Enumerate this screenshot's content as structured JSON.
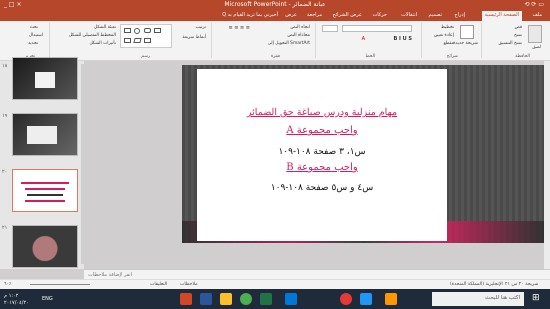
{
  "window": {
    "title": "Microsoft PowerPoint - عبانة الضمائر",
    "controls": [
      "_",
      "□",
      "×"
    ],
    "quick_access": "⟲ ⟳ ▭"
  },
  "tabs": [
    "ملف",
    "الصفحة الرئيسية",
    "إدراج",
    "تصميم",
    "انتقالات",
    "حركات",
    "عرض الشرائح",
    "مراجعة",
    "عرض",
    "Q أخبرني بما تريد القيام به"
  ],
  "ribbon": {
    "paste": "لصق",
    "clipboard_items": [
      "قص",
      "نسخ",
      "نسخ التنسيق"
    ],
    "clipboard_label": "الحافظة",
    "new_slide": "شريحة جديدة",
    "slides_items": [
      "تخطيط",
      "إعادة تعيين",
      "مقطع"
    ],
    "slides_label": "شرائح",
    "font_label": "الخط",
    "paragraph_items": [
      "اتجاه النص",
      "محاذاة النص",
      "التحويل إلى SmartArt"
    ],
    "paragraph_label": "فقرة",
    "drawing_items": [
      "ترتيب",
      "أنماط سريعة",
      "تعبئة الشكل",
      "المخطط التفصيلي للشكل",
      "تأثيرات الشكل"
    ],
    "drawing_label": "رسم",
    "editing_items": [
      "بحث",
      "استبدال",
      "تحديد"
    ],
    "editing_label": "تحرير"
  },
  "thumbnails": [
    {
      "num": "١٨"
    },
    {
      "num": "١٩"
    },
    {
      "num": "٢٠"
    },
    {
      "num": "٢١"
    }
  ],
  "slide": {
    "line1": "مهام منزلية ودرس صياغة حق الضمائر",
    "line2": "واجب مجموعة A",
    "line3": "س١، ٣ صفحة ١٠٨-١٠٩",
    "line4": "واجب مجموعة B",
    "line5": "س٤ و س٥ صفحة ١٠٨-١٠٩"
  },
  "notes_placeholder": "انقر لإضافة ملاحظات",
  "status": {
    "slide_info": "شريحة ٢٠ من ٢١",
    "language": "الإنجليزية (المملكة المتحدة)",
    "notes": "ملاحظات",
    "comments": "التعليقات",
    "zoom": "٦٠٪"
  },
  "taskbar": {
    "search_placeholder": "اكتب هنا للبحث",
    "time": "١:٠٢ م",
    "date": "٢٠١٧/٠٤/٢٠",
    "lang": "ENG"
  }
}
